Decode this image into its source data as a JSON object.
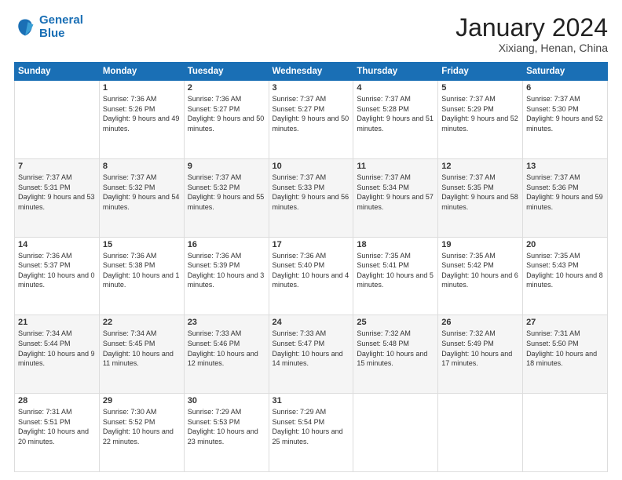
{
  "logo": {
    "line1": "General",
    "line2": "Blue"
  },
  "title": "January 2024",
  "subtitle": "Xixiang, Henan, China",
  "days": [
    "Sunday",
    "Monday",
    "Tuesday",
    "Wednesday",
    "Thursday",
    "Friday",
    "Saturday"
  ],
  "weeks": [
    [
      {
        "num": "",
        "sunrise": "",
        "sunset": "",
        "daylight": ""
      },
      {
        "num": "1",
        "sunrise": "Sunrise: 7:36 AM",
        "sunset": "Sunset: 5:26 PM",
        "daylight": "Daylight: 9 hours and 49 minutes."
      },
      {
        "num": "2",
        "sunrise": "Sunrise: 7:36 AM",
        "sunset": "Sunset: 5:27 PM",
        "daylight": "Daylight: 9 hours and 50 minutes."
      },
      {
        "num": "3",
        "sunrise": "Sunrise: 7:37 AM",
        "sunset": "Sunset: 5:27 PM",
        "daylight": "Daylight: 9 hours and 50 minutes."
      },
      {
        "num": "4",
        "sunrise": "Sunrise: 7:37 AM",
        "sunset": "Sunset: 5:28 PM",
        "daylight": "Daylight: 9 hours and 51 minutes."
      },
      {
        "num": "5",
        "sunrise": "Sunrise: 7:37 AM",
        "sunset": "Sunset: 5:29 PM",
        "daylight": "Daylight: 9 hours and 52 minutes."
      },
      {
        "num": "6",
        "sunrise": "Sunrise: 7:37 AM",
        "sunset": "Sunset: 5:30 PM",
        "daylight": "Daylight: 9 hours and 52 minutes."
      }
    ],
    [
      {
        "num": "7",
        "sunrise": "Sunrise: 7:37 AM",
        "sunset": "Sunset: 5:31 PM",
        "daylight": "Daylight: 9 hours and 53 minutes."
      },
      {
        "num": "8",
        "sunrise": "Sunrise: 7:37 AM",
        "sunset": "Sunset: 5:32 PM",
        "daylight": "Daylight: 9 hours and 54 minutes."
      },
      {
        "num": "9",
        "sunrise": "Sunrise: 7:37 AM",
        "sunset": "Sunset: 5:32 PM",
        "daylight": "Daylight: 9 hours and 55 minutes."
      },
      {
        "num": "10",
        "sunrise": "Sunrise: 7:37 AM",
        "sunset": "Sunset: 5:33 PM",
        "daylight": "Daylight: 9 hours and 56 minutes."
      },
      {
        "num": "11",
        "sunrise": "Sunrise: 7:37 AM",
        "sunset": "Sunset: 5:34 PM",
        "daylight": "Daylight: 9 hours and 57 minutes."
      },
      {
        "num": "12",
        "sunrise": "Sunrise: 7:37 AM",
        "sunset": "Sunset: 5:35 PM",
        "daylight": "Daylight: 9 hours and 58 minutes."
      },
      {
        "num": "13",
        "sunrise": "Sunrise: 7:37 AM",
        "sunset": "Sunset: 5:36 PM",
        "daylight": "Daylight: 9 hours and 59 minutes."
      }
    ],
    [
      {
        "num": "14",
        "sunrise": "Sunrise: 7:36 AM",
        "sunset": "Sunset: 5:37 PM",
        "daylight": "Daylight: 10 hours and 0 minutes."
      },
      {
        "num": "15",
        "sunrise": "Sunrise: 7:36 AM",
        "sunset": "Sunset: 5:38 PM",
        "daylight": "Daylight: 10 hours and 1 minute."
      },
      {
        "num": "16",
        "sunrise": "Sunrise: 7:36 AM",
        "sunset": "Sunset: 5:39 PM",
        "daylight": "Daylight: 10 hours and 3 minutes."
      },
      {
        "num": "17",
        "sunrise": "Sunrise: 7:36 AM",
        "sunset": "Sunset: 5:40 PM",
        "daylight": "Daylight: 10 hours and 4 minutes."
      },
      {
        "num": "18",
        "sunrise": "Sunrise: 7:35 AM",
        "sunset": "Sunset: 5:41 PM",
        "daylight": "Daylight: 10 hours and 5 minutes."
      },
      {
        "num": "19",
        "sunrise": "Sunrise: 7:35 AM",
        "sunset": "Sunset: 5:42 PM",
        "daylight": "Daylight: 10 hours and 6 minutes."
      },
      {
        "num": "20",
        "sunrise": "Sunrise: 7:35 AM",
        "sunset": "Sunset: 5:43 PM",
        "daylight": "Daylight: 10 hours and 8 minutes."
      }
    ],
    [
      {
        "num": "21",
        "sunrise": "Sunrise: 7:34 AM",
        "sunset": "Sunset: 5:44 PM",
        "daylight": "Daylight: 10 hours and 9 minutes."
      },
      {
        "num": "22",
        "sunrise": "Sunrise: 7:34 AM",
        "sunset": "Sunset: 5:45 PM",
        "daylight": "Daylight: 10 hours and 11 minutes."
      },
      {
        "num": "23",
        "sunrise": "Sunrise: 7:33 AM",
        "sunset": "Sunset: 5:46 PM",
        "daylight": "Daylight: 10 hours and 12 minutes."
      },
      {
        "num": "24",
        "sunrise": "Sunrise: 7:33 AM",
        "sunset": "Sunset: 5:47 PM",
        "daylight": "Daylight: 10 hours and 14 minutes."
      },
      {
        "num": "25",
        "sunrise": "Sunrise: 7:32 AM",
        "sunset": "Sunset: 5:48 PM",
        "daylight": "Daylight: 10 hours and 15 minutes."
      },
      {
        "num": "26",
        "sunrise": "Sunrise: 7:32 AM",
        "sunset": "Sunset: 5:49 PM",
        "daylight": "Daylight: 10 hours and 17 minutes."
      },
      {
        "num": "27",
        "sunrise": "Sunrise: 7:31 AM",
        "sunset": "Sunset: 5:50 PM",
        "daylight": "Daylight: 10 hours and 18 minutes."
      }
    ],
    [
      {
        "num": "28",
        "sunrise": "Sunrise: 7:31 AM",
        "sunset": "Sunset: 5:51 PM",
        "daylight": "Daylight: 10 hours and 20 minutes."
      },
      {
        "num": "29",
        "sunrise": "Sunrise: 7:30 AM",
        "sunset": "Sunset: 5:52 PM",
        "daylight": "Daylight: 10 hours and 22 minutes."
      },
      {
        "num": "30",
        "sunrise": "Sunrise: 7:29 AM",
        "sunset": "Sunset: 5:53 PM",
        "daylight": "Daylight: 10 hours and 23 minutes."
      },
      {
        "num": "31",
        "sunrise": "Sunrise: 7:29 AM",
        "sunset": "Sunset: 5:54 PM",
        "daylight": "Daylight: 10 hours and 25 minutes."
      },
      {
        "num": "",
        "sunrise": "",
        "sunset": "",
        "daylight": ""
      },
      {
        "num": "",
        "sunrise": "",
        "sunset": "",
        "daylight": ""
      },
      {
        "num": "",
        "sunrise": "",
        "sunset": "",
        "daylight": ""
      }
    ]
  ]
}
